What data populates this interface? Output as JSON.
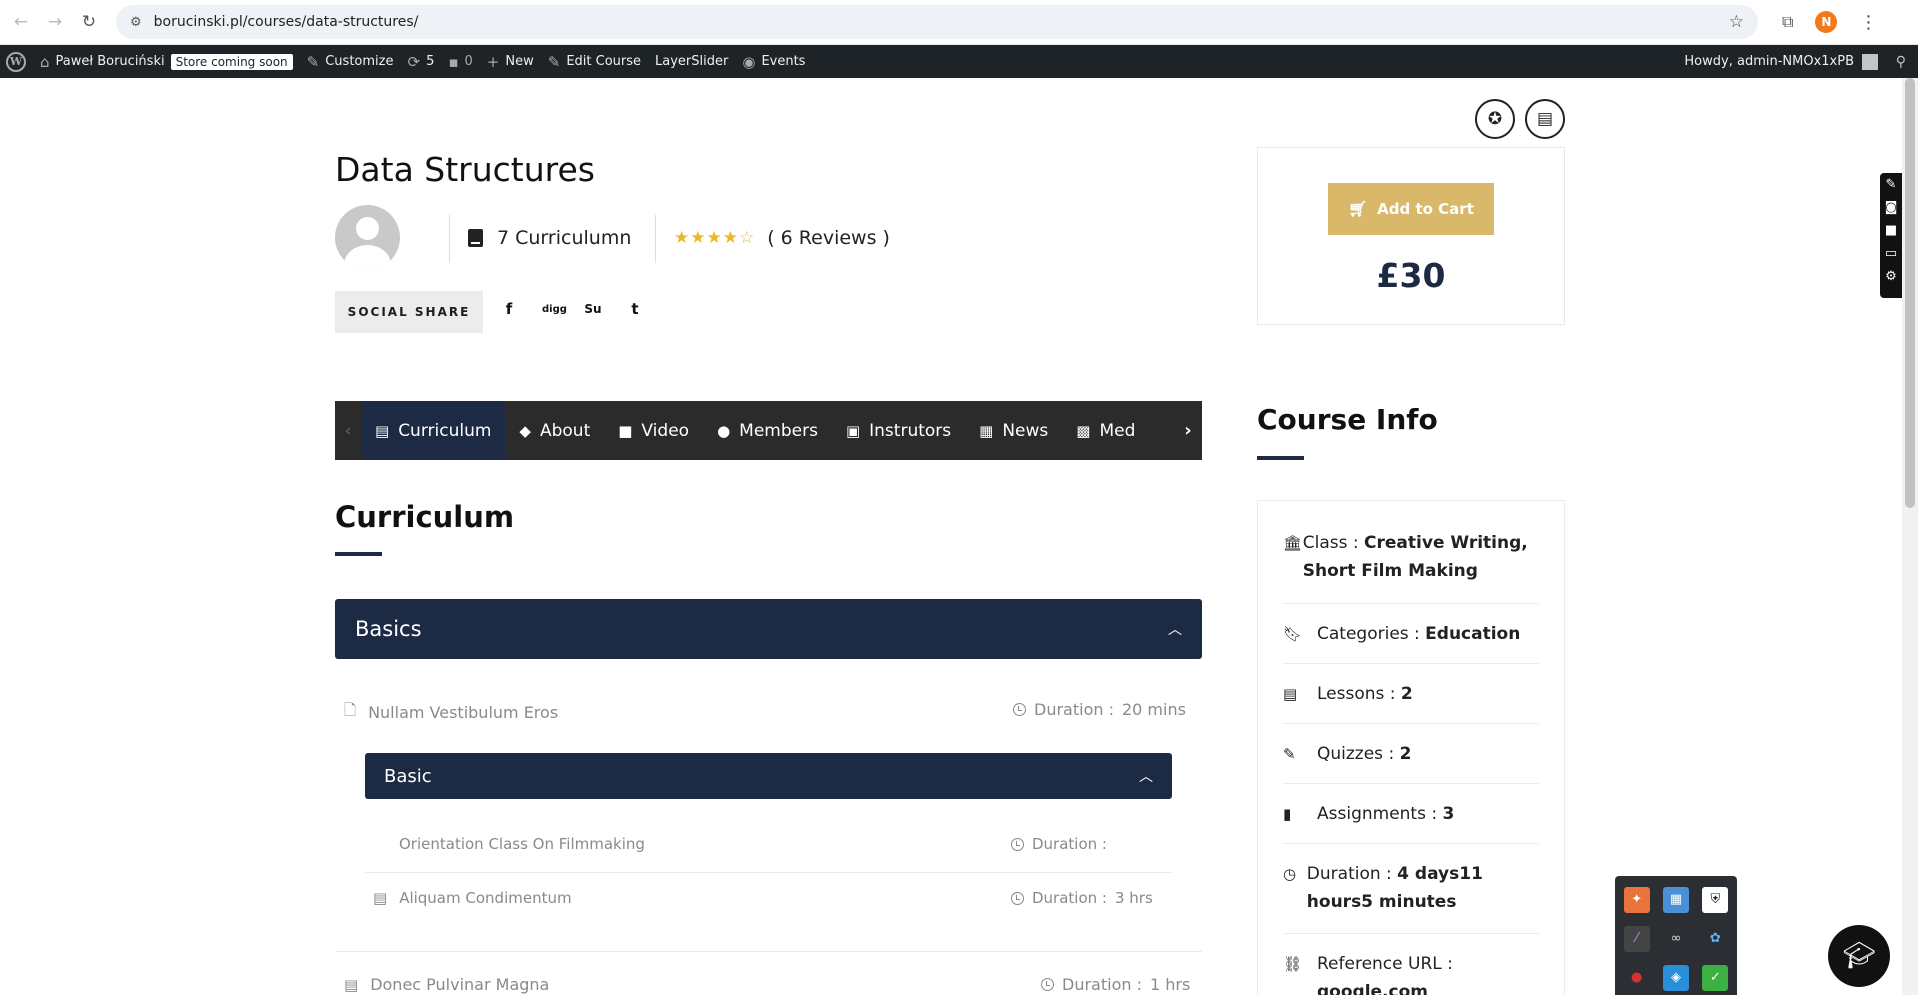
{
  "browser": {
    "url": "borucinski.pl/courses/data-structures/",
    "profile_initial": "N"
  },
  "adminbar": {
    "site_name": "Paweł Boruciński",
    "store_badge": "Store coming soon",
    "customize": "Customize",
    "updates_count": "5",
    "comments_count": "0",
    "new": "New",
    "edit_course": "Edit Course",
    "layerslider": "LayerSlider",
    "events": "Events",
    "howdy": "Howdy, admin-NMOx1xPB"
  },
  "course": {
    "title": "Data Structures",
    "curriculum_count": "7 Curriculumn",
    "rating_stars": "★★★★☆",
    "reviews": "( 6 Reviews )",
    "social_share": "SOCIAL SHARE",
    "social_icons": [
      "f",
      "digg",
      "Su",
      "t"
    ]
  },
  "cart": {
    "button": "Add to Cart",
    "price": "£30"
  },
  "tabs": [
    {
      "label": "Curriculum",
      "icon": "▤"
    },
    {
      "label": "About",
      "icon": "◆"
    },
    {
      "label": "Video",
      "icon": "■"
    },
    {
      "label": "Members",
      "icon": "●"
    },
    {
      "label": "Instrutors",
      "icon": "▣"
    },
    {
      "label": "News",
      "icon": "▦"
    },
    {
      "label": "Med",
      "icon": "▩"
    }
  ],
  "curriculum": {
    "title": "Curriculum",
    "section1": "Basics",
    "lesson1": {
      "name": "Nullam Vestibulum Eros",
      "duration_label": "Duration :",
      "duration": "20 mins"
    },
    "section2": "Basic",
    "lesson2": {
      "name": "Orientation Class On Filmmaking",
      "duration_label": "Duration :",
      "duration": ""
    },
    "lesson3": {
      "name": "Aliquam Condimentum",
      "duration_label": "Duration :",
      "duration": "3 hrs"
    },
    "lesson4": {
      "name": "Donec Pulvinar Magna",
      "duration_label": "Duration :",
      "duration": "1 hrs"
    }
  },
  "course_info": {
    "title": "Course Info",
    "class_label": "Class :",
    "class_value": "Creative Writing, Short Film Making",
    "categories_label": "Categories :",
    "categories_value": "Education",
    "lessons_label": "Lessons :",
    "lessons_value": "2",
    "quizzes_label": "Quizzes :",
    "quizzes_value": "2",
    "assignments_label": "Assignments :",
    "assignments_value": "3",
    "duration_label": "Duration :",
    "duration_value": "4 days11 hours5 minutes",
    "reference_label": "Reference URL :",
    "reference_value": "google.com"
  },
  "colors": {
    "navy": "#1d2a44",
    "gold": "#d9b86a",
    "adminbar": "#1d2327"
  }
}
